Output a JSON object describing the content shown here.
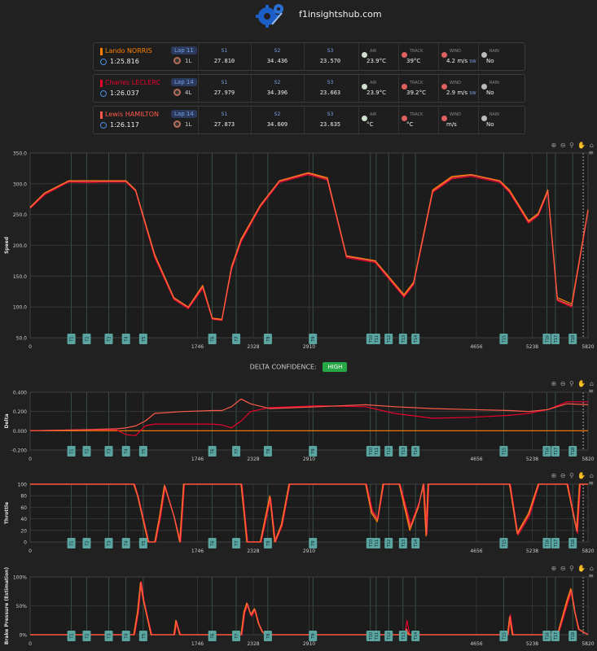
{
  "header": {
    "site_name": "f1insightshub.com",
    "logo_icon": "gears-icon"
  },
  "drivers": [
    {
      "name": "Lando NORRIS",
      "color": "#ff8000",
      "lap": "Lap 11",
      "laptime": "1:25.816",
      "tyre_age": "1L",
      "s1_label": "S1",
      "s1": "27.810",
      "s2_label": "S2",
      "s2": "34.436",
      "s3_label": "S3",
      "s3": "23.570",
      "air_label": "AIR",
      "air": "23.9°C",
      "track_label": "TRACK",
      "track": "39°C",
      "wind_label": "WIND",
      "wind": "4.2 m/s",
      "wind_dir": "SW",
      "rain_label": "RAIN",
      "rain": "No"
    },
    {
      "name": "Charles LECLERC",
      "color": "#e8002d",
      "lap": "Lap 14",
      "laptime": "1:26.037",
      "tyre_age": "4L",
      "s1_label": "S1",
      "s1": "27.979",
      "s2_label": "S2",
      "s2": "34.396",
      "s3_label": "S3",
      "s3": "23.663",
      "air_label": "AIR",
      "air": "23.9°C",
      "track_label": "TRACK",
      "track": "39.2°C",
      "wind_label": "WIND",
      "wind": "2.9 m/s",
      "wind_dir": "SW",
      "rain_label": "RAIN",
      "rain": "No"
    },
    {
      "name": "Lewis HAMILTON",
      "color": "#ff5a4a",
      "lap": "Lap 14",
      "laptime": "1:26.117",
      "tyre_age": "1L",
      "s1_label": "S1",
      "s1": "27.873",
      "s2_label": "S2",
      "s2": "34.609",
      "s3_label": "S3",
      "s3": "23.635",
      "air_label": "AIR",
      "air": "°C",
      "track_label": "TRACK",
      "track": "°C",
      "wind_label": "WIND",
      "wind": "m/s",
      "wind_dir": "",
      "rain_label": "RAIN",
      "rain": "No"
    }
  ],
  "delta": {
    "label": "DELTA CONFIDENCE:",
    "value": "HIGH"
  },
  "toolbar": {
    "icons": "⊕ ⊖ ⚲ ✋ ⌂ ≡"
  },
  "chart_data": [
    {
      "type": "line",
      "id": "speed",
      "ylabel": "Speed",
      "ylim": [
        50,
        350
      ],
      "yticks": [
        "50.0",
        "100.0",
        "150.0",
        "200.0",
        "250.0",
        "300.0",
        "350.0"
      ],
      "xlim": [
        0,
        5820
      ],
      "xticks": [
        "0",
        "1746",
        "2328",
        "2910",
        "4656",
        "5238",
        "5820"
      ],
      "corners": [
        "T1",
        "T2",
        "T3",
        "T4",
        "T5",
        "T6",
        "T7",
        "T8",
        "T9",
        "T10",
        "T11",
        "T12",
        "T13",
        "T14",
        "T15",
        "T16",
        "T17",
        "T18"
      ],
      "corner_x": [
        430,
        590,
        820,
        1000,
        1180,
        1900,
        2150,
        2480,
        2950,
        3550,
        3610,
        3740,
        3890,
        4020,
        4940,
        5390,
        5480,
        5660
      ],
      "series": [
        {
          "color": "#ff8000",
          "x": [
            0,
            150,
            400,
            600,
            800,
            1000,
            1100,
            1300,
            1500,
            1650,
            1800,
            1900,
            2000,
            2100,
            2200,
            2400,
            2600,
            2900,
            3100,
            3300,
            3600,
            3900,
            4000,
            4200,
            4400,
            4600,
            4900,
            5000,
            5200,
            5300,
            5400,
            5500,
            5650,
            5820
          ],
          "y": [
            262,
            285,
            305,
            305,
            305,
            305,
            290,
            185,
            115,
            100,
            135,
            82,
            80,
            165,
            210,
            265,
            305,
            318,
            310,
            183,
            175,
            120,
            140,
            290,
            312,
            315,
            305,
            290,
            240,
            252,
            290,
            115,
            105,
            258
          ]
        },
        {
          "color": "#e8002d",
          "x": [
            0,
            150,
            400,
            600,
            800,
            1000,
            1100,
            1300,
            1500,
            1650,
            1800,
            1900,
            2000,
            2100,
            2200,
            2400,
            2600,
            2900,
            3100,
            3300,
            3600,
            3900,
            4000,
            4200,
            4400,
            4600,
            4900,
            5000,
            5200,
            5300,
            5400,
            5500,
            5650,
            5820
          ],
          "y": [
            260,
            282,
            303,
            302,
            303,
            303,
            288,
            180,
            112,
            97,
            130,
            80,
            78,
            160,
            205,
            262,
            302,
            315,
            306,
            180,
            172,
            116,
            136,
            286,
            308,
            312,
            302,
            286,
            236,
            248,
            286,
            110,
            100,
            255
          ]
        },
        {
          "color": "#ff5a4a",
          "x": [
            0,
            150,
            400,
            600,
            800,
            1000,
            1100,
            1300,
            1500,
            1650,
            1800,
            1900,
            2000,
            2100,
            2200,
            2400,
            2600,
            2900,
            3100,
            3300,
            3600,
            3900,
            4000,
            4200,
            4400,
            4600,
            4900,
            5000,
            5200,
            5300,
            5400,
            5500,
            5650,
            5820
          ],
          "y": [
            261,
            284,
            304,
            304,
            304,
            304,
            289,
            183,
            114,
            99,
            133,
            81,
            79,
            163,
            208,
            264,
            304,
            317,
            308,
            182,
            174,
            118,
            138,
            288,
            310,
            314,
            304,
            288,
            238,
            250,
            288,
            112,
            102,
            257
          ]
        }
      ]
    },
    {
      "type": "line",
      "id": "delta",
      "ylabel": "Delta",
      "ylim": [
        -0.2,
        0.4
      ],
      "yticks": [
        "-0.200",
        "0.000",
        "0.200",
        "0.400"
      ],
      "xlim": [
        0,
        5820
      ],
      "xticks": [
        "0",
        "1746",
        "2328",
        "2910",
        "4656",
        "5238",
        "5820"
      ],
      "series": [
        {
          "color": "#ff8000",
          "x": [
            0,
            5820
          ],
          "y": [
            0,
            0
          ]
        },
        {
          "color": "#e8002d",
          "x": [
            0,
            500,
            900,
            1000,
            1100,
            1200,
            1300,
            1600,
            1900,
            2000,
            2100,
            2200,
            2300,
            2500,
            3000,
            3500,
            3800,
            4200,
            4600,
            5000,
            5200,
            5400,
            5600,
            5820
          ],
          "y": [
            0,
            0.01,
            0.01,
            -0.04,
            -0.05,
            0.05,
            0.07,
            0.07,
            0.07,
            0.06,
            0.03,
            0.1,
            0.2,
            0.24,
            0.26,
            0.25,
            0.18,
            0.13,
            0.14,
            0.16,
            0.18,
            0.22,
            0.3,
            0.3
          ]
        },
        {
          "color": "#ff5a4a",
          "x": [
            0,
            500,
            900,
            1000,
            1100,
            1200,
            1300,
            1600,
            1900,
            2000,
            2100,
            2200,
            2300,
            2500,
            3000,
            3500,
            3800,
            4200,
            4600,
            5000,
            5200,
            5400,
            5600,
            5820
          ],
          "y": [
            0,
            0.01,
            0.02,
            0.03,
            0.05,
            0.1,
            0.18,
            0.2,
            0.21,
            0.21,
            0.25,
            0.33,
            0.28,
            0.23,
            0.25,
            0.27,
            0.25,
            0.23,
            0.22,
            0.21,
            0.2,
            0.22,
            0.28,
            0.27
          ]
        }
      ]
    },
    {
      "type": "line",
      "id": "throttle",
      "ylabel": "Throttle",
      "ylim": [
        0,
        100
      ],
      "yticks": [
        "0",
        "20",
        "40",
        "60",
        "80",
        "100"
      ],
      "xlim": [
        0,
        5820
      ],
      "xticks": [
        "0",
        "1746",
        "2328",
        "2910",
        "4656",
        "5238",
        "5820"
      ],
      "series": [
        {
          "color": "#ff8000",
          "x": [
            0,
            1080,
            1120,
            1230,
            1300,
            1350,
            1400,
            1500,
            1560,
            1600,
            2200,
            2260,
            2400,
            2500,
            2550,
            2620,
            2700,
            2750,
            3500,
            3560,
            3620,
            3680,
            3850,
            3960,
            4050,
            4100,
            4130,
            4150,
            5000,
            5080,
            5200,
            5300,
            5600,
            5700,
            5730,
            5820
          ],
          "y": [
            100,
            100,
            80,
            0,
            0,
            45,
            98,
            45,
            0,
            100,
            100,
            0,
            0,
            80,
            0,
            30,
            100,
            100,
            100,
            50,
            35,
            100,
            100,
            20,
            60,
            100,
            10,
            100,
            100,
            15,
            50,
            100,
            100,
            20,
            100,
            100
          ]
        },
        {
          "color": "#e8002d",
          "x": [
            0,
            1090,
            1130,
            1240,
            1310,
            1360,
            1410,
            1510,
            1570,
            1610,
            2210,
            2270,
            2410,
            2510,
            2560,
            2630,
            2710,
            2760,
            3510,
            3570,
            3630,
            3690,
            3860,
            3970,
            4060,
            4110,
            4140,
            4160,
            5010,
            5090,
            5210,
            5310,
            5610,
            5710,
            5740,
            5820
          ],
          "y": [
            100,
            100,
            78,
            0,
            0,
            42,
            96,
            40,
            0,
            100,
            100,
            0,
            0,
            75,
            0,
            28,
            100,
            100,
            100,
            55,
            40,
            100,
            100,
            30,
            70,
            100,
            15,
            100,
            100,
            12,
            45,
            100,
            100,
            15,
            100,
            100
          ]
        },
        {
          "color": "#ff5a4a",
          "x": [
            0,
            1085,
            1125,
            1235,
            1305,
            1355,
            1405,
            1505,
            1565,
            1605,
            2205,
            2265,
            2405,
            2505,
            2555,
            2625,
            2705,
            2755,
            3505,
            3565,
            3625,
            3685,
            3855,
            3965,
            4055,
            4105,
            4135,
            4155,
            5005,
            5085,
            5205,
            5305,
            5605,
            5705,
            5735,
            5820
          ],
          "y": [
            100,
            100,
            79,
            0,
            0,
            44,
            97,
            42,
            0,
            100,
            100,
            0,
            0,
            78,
            0,
            29,
            100,
            100,
            100,
            52,
            38,
            100,
            100,
            25,
            65,
            100,
            12,
            100,
            100,
            14,
            48,
            100,
            100,
            18,
            100,
            100
          ]
        }
      ]
    },
    {
      "type": "line",
      "id": "brake",
      "ylabel": "Brake Pressure (Estimation)",
      "ylim": [
        0,
        100
      ],
      "yticks": [
        "0%",
        "50%",
        "100%"
      ],
      "xlim": [
        0,
        5820
      ],
      "xticks": [
        "0",
        "1746",
        "2328",
        "2910",
        "4656",
        "5238",
        "5820"
      ],
      "series": [
        {
          "color": "#ff8000",
          "x": [
            0,
            1080,
            1120,
            1150,
            1180,
            1220,
            1260,
            1500,
            1520,
            1540,
            1560,
            2200,
            2230,
            2260,
            2300,
            2340,
            2380,
            2420,
            2460,
            3900,
            3920,
            3950,
            4980,
            5000,
            5030,
            5500,
            5600,
            5640,
            5680,
            5720,
            5820
          ],
          "y": [
            0,
            0,
            40,
            90,
            60,
            30,
            0,
            0,
            25,
            12,
            0,
            0,
            40,
            55,
            35,
            45,
            20,
            5,
            0,
            0,
            5,
            0,
            0,
            30,
            0,
            0,
            60,
            80,
            40,
            10,
            0
          ]
        },
        {
          "color": "#e8002d",
          "x": [
            0,
            1090,
            1130,
            1160,
            1190,
            1230,
            1270,
            1510,
            1530,
            1550,
            1570,
            2210,
            2240,
            2270,
            2310,
            2350,
            2390,
            2430,
            2470,
            3910,
            3930,
            3960,
            4990,
            5010,
            5040,
            5510,
            5610,
            5650,
            5690,
            5730,
            5820
          ],
          "y": [
            0,
            0,
            38,
            92,
            58,
            28,
            0,
            0,
            22,
            10,
            0,
            0,
            38,
            52,
            32,
            42,
            18,
            4,
            0,
            0,
            25,
            0,
            0,
            35,
            0,
            0,
            55,
            75,
            35,
            8,
            0
          ]
        },
        {
          "color": "#ff5a4a",
          "x": [
            0,
            1085,
            1125,
            1155,
            1185,
            1225,
            1265,
            1505,
            1525,
            1545,
            1565,
            2205,
            2235,
            2265,
            2305,
            2345,
            2385,
            2425,
            2465,
            3905,
            3925,
            3955,
            4985,
            5005,
            5035,
            5505,
            5605,
            5645,
            5685,
            5725,
            5820
          ],
          "y": [
            0,
            0,
            39,
            91,
            59,
            29,
            0,
            0,
            24,
            11,
            0,
            0,
            39,
            54,
            34,
            44,
            19,
            5,
            0,
            0,
            10,
            0,
            0,
            32,
            0,
            0,
            58,
            78,
            38,
            9,
            0
          ]
        }
      ]
    }
  ]
}
